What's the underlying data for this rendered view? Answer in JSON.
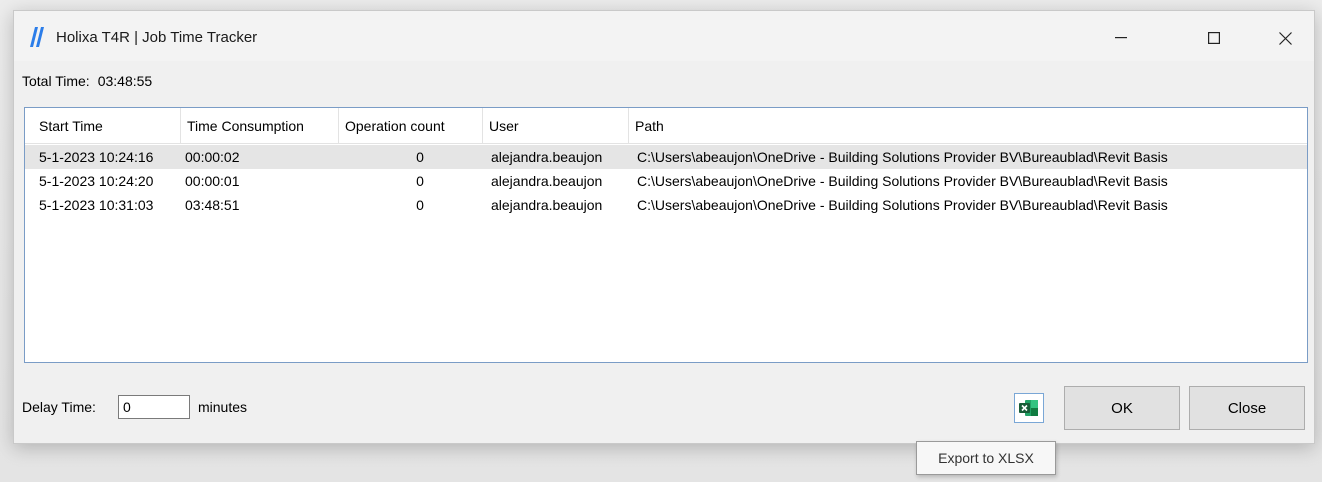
{
  "window": {
    "title": "Holixa T4R | Job Time Tracker",
    "controls": {
      "minimize": "—",
      "maximize": "☐",
      "close": "✕"
    }
  },
  "summary": {
    "total_label": "Total Time:",
    "total_value": "03:48:55"
  },
  "grid": {
    "columns": [
      "Start Time",
      "Time Consumption",
      "Operation count",
      "User",
      "Path"
    ],
    "rows": [
      {
        "start": "5-1-2023 10:24:16",
        "consumption": "00:00:02",
        "count": "0",
        "user": "alejandra.beaujon",
        "path": "C:\\Users\\abeaujon\\OneDrive - Building Solutions Provider BV\\Bureaublad\\Revit Basis",
        "selected": true
      },
      {
        "start": "5-1-2023 10:24:20",
        "consumption": "00:00:01",
        "count": "0",
        "user": "alejandra.beaujon",
        "path": "C:\\Users\\abeaujon\\OneDrive - Building Solutions Provider BV\\Bureaublad\\Revit Basis",
        "selected": false
      },
      {
        "start": "5-1-2023 10:31:03",
        "consumption": "03:48:51",
        "count": "0",
        "user": "alejandra.beaujon",
        "path": "C:\\Users\\abeaujon\\OneDrive - Building Solutions Provider BV\\Bureaublad\\Revit Basis",
        "selected": false
      }
    ]
  },
  "footer": {
    "delay_label": "Delay Time:",
    "delay_value": "0",
    "minutes_label": "minutes",
    "ok_label": "OK",
    "close_label": "Close",
    "export_tooltip": "Export to XLSX"
  },
  "icons": {
    "app": "holixa-logo-icon",
    "export": "excel-icon"
  },
  "colors": {
    "logo": "#2b7de9",
    "excel_green": "#1e7145",
    "grid_border": "#7a9cc6",
    "selected_row": "#e5e5e5"
  }
}
